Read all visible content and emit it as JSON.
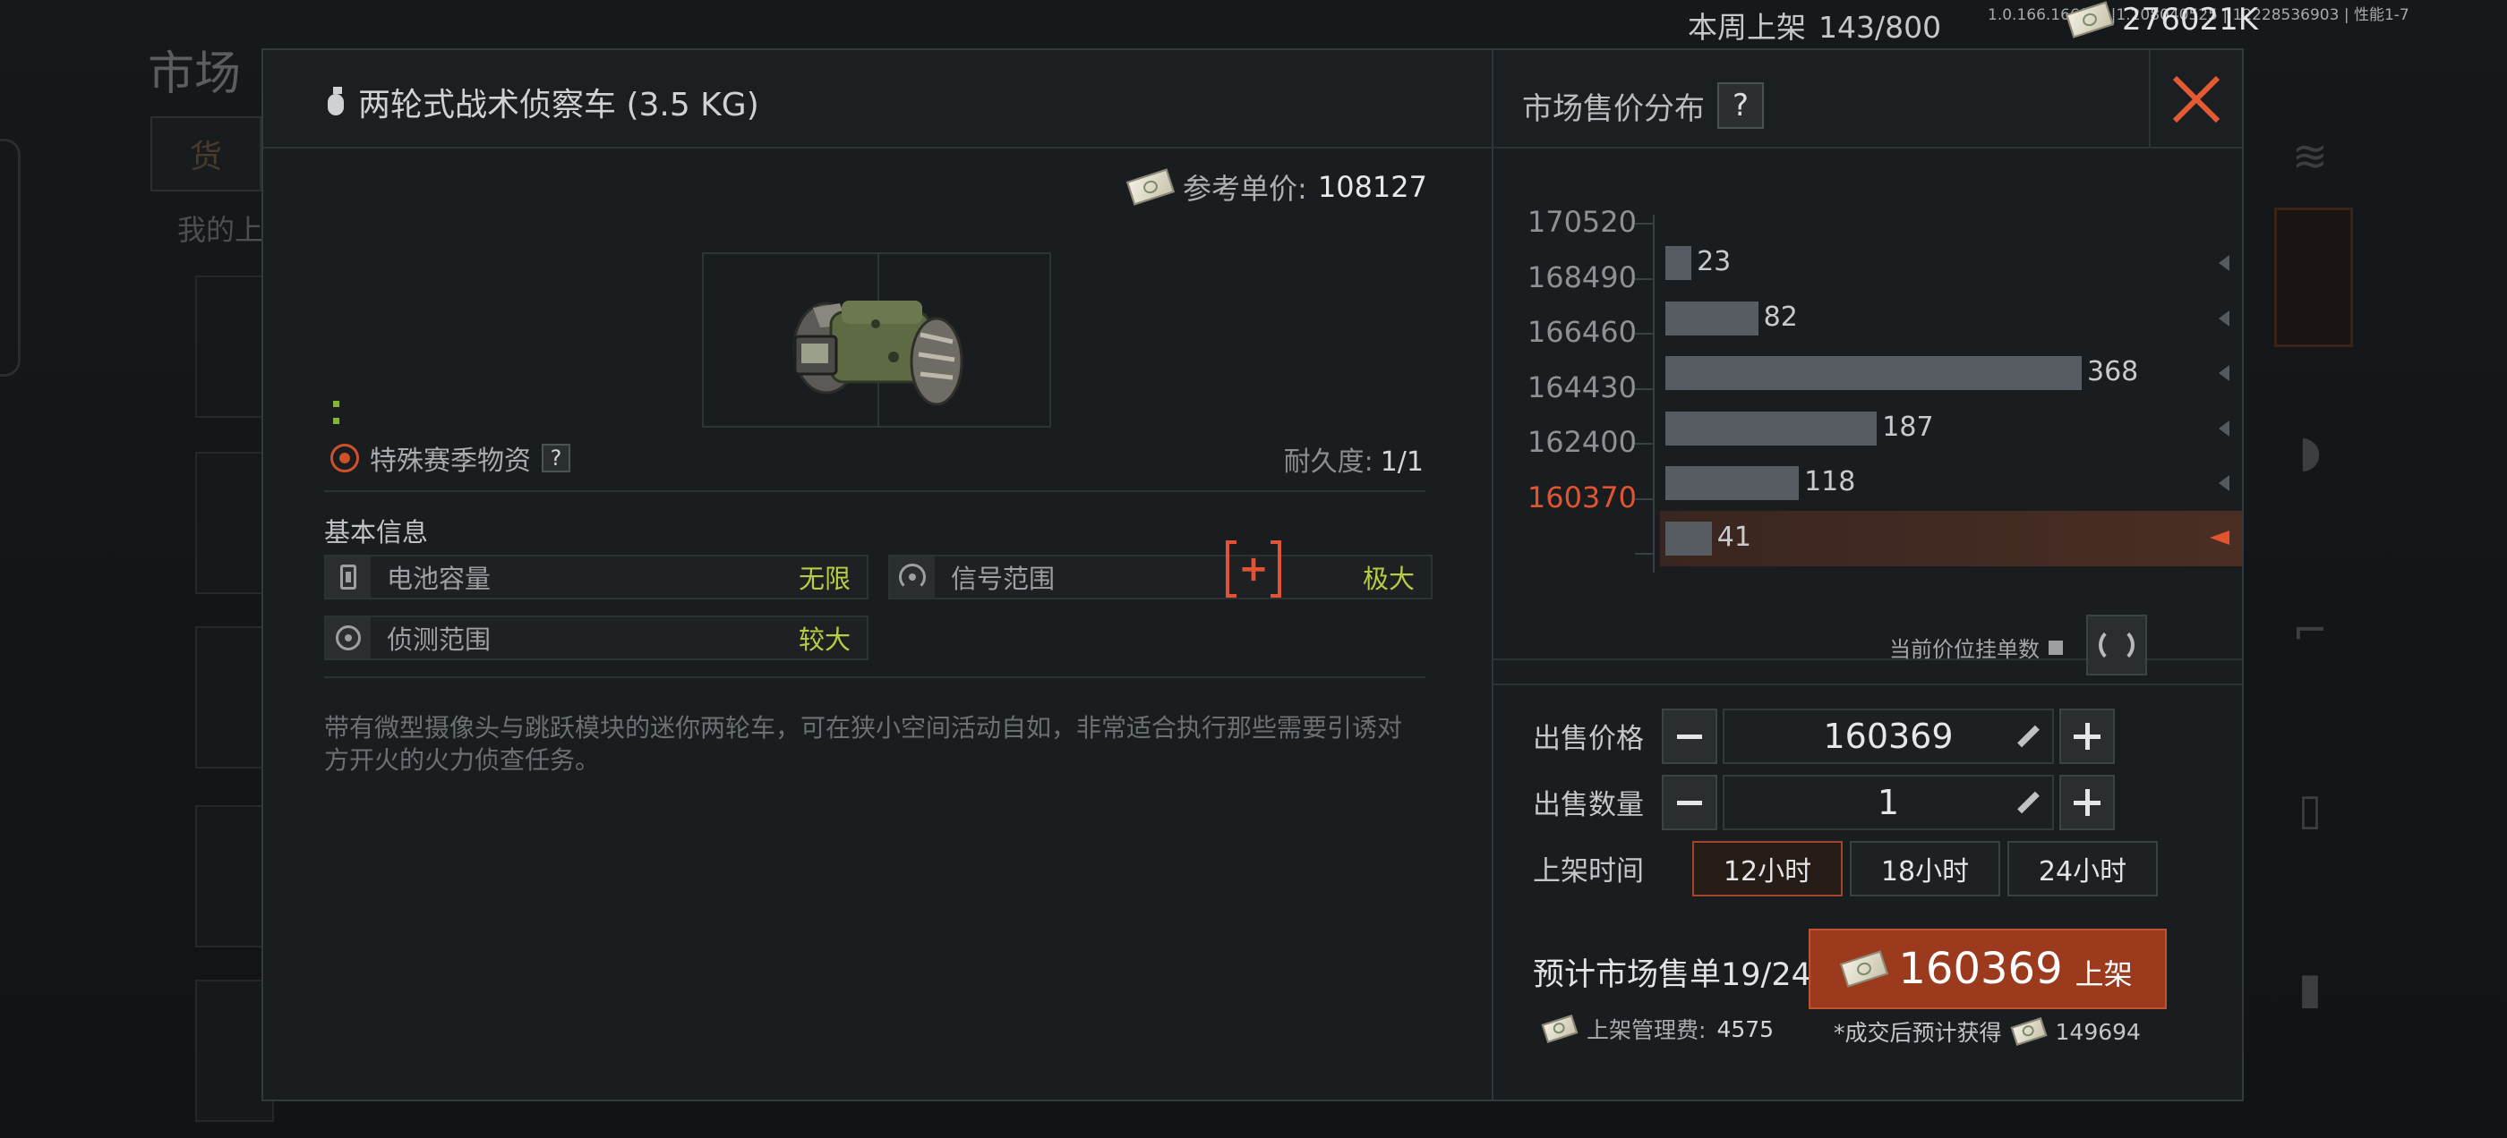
{
  "background": {
    "title": "市场",
    "tab": "货",
    "sub_label": "我的上",
    "weekly_listed_label": "本周上架",
    "weekly_listed_value": "143/800",
    "currency_balance": "276021K",
    "version": "1.0.166.166(13)|1.208040525 | 12228536903 | 性能1-7"
  },
  "item": {
    "name": "两轮式战术侦察车 (3.5 KG)",
    "ref_price_label": "参考单价:",
    "ref_price_value": "108127",
    "season_label": "特殊赛季物资",
    "help_mark": "?",
    "durability_label": "耐久度:",
    "durability_value": "1/1",
    "basic_info_label": "基本信息",
    "attributes": [
      {
        "name": "电池容量",
        "value": "无限",
        "icon": "battery-icon"
      },
      {
        "name": "信号范围",
        "value": "极大",
        "icon": "signal-icon"
      },
      {
        "name": "侦测范围",
        "value": "较大",
        "icon": "target-icon"
      }
    ],
    "description": "带有微型摄像头与跳跃模块的迷你两轮车，可在狭小空间活动自如，非常适合执行那些需要引诱对方开火的火力侦查任务。"
  },
  "market": {
    "title": "市场售价分布",
    "help_mark": "?",
    "current_price_count_legend": "当前价位挂单数",
    "chart_data": {
      "type": "bar",
      "orientation": "horizontal",
      "categories": [
        "170520",
        "168490",
        "166460",
        "164430",
        "162400",
        "160370"
      ],
      "values": [
        23,
        82,
        368,
        187,
        118,
        41
      ],
      "highlighted_category": "160370",
      "highlight_color": "#e25430",
      "bar_color": "#575c62"
    }
  },
  "sell_form": {
    "price_label": "出售价格",
    "price_value": "160369",
    "quantity_label": "出售数量",
    "quantity_value": "1",
    "duration_label": "上架时间",
    "durations": [
      "12小时",
      "18小时",
      "24小时"
    ],
    "selected_duration": "12小时",
    "est_orders": "预计市场售单19/24",
    "list_button_price": "160369",
    "list_button_label": "上架",
    "fee_label": "上架管理费:",
    "fee_value": "4575",
    "after_sale_label": "*成交后预计获得",
    "after_sale_value": "149694"
  },
  "colors": {
    "accent": "#e25430",
    "attr_value": "#b8cc42",
    "list_button": "#9c3a1e"
  }
}
